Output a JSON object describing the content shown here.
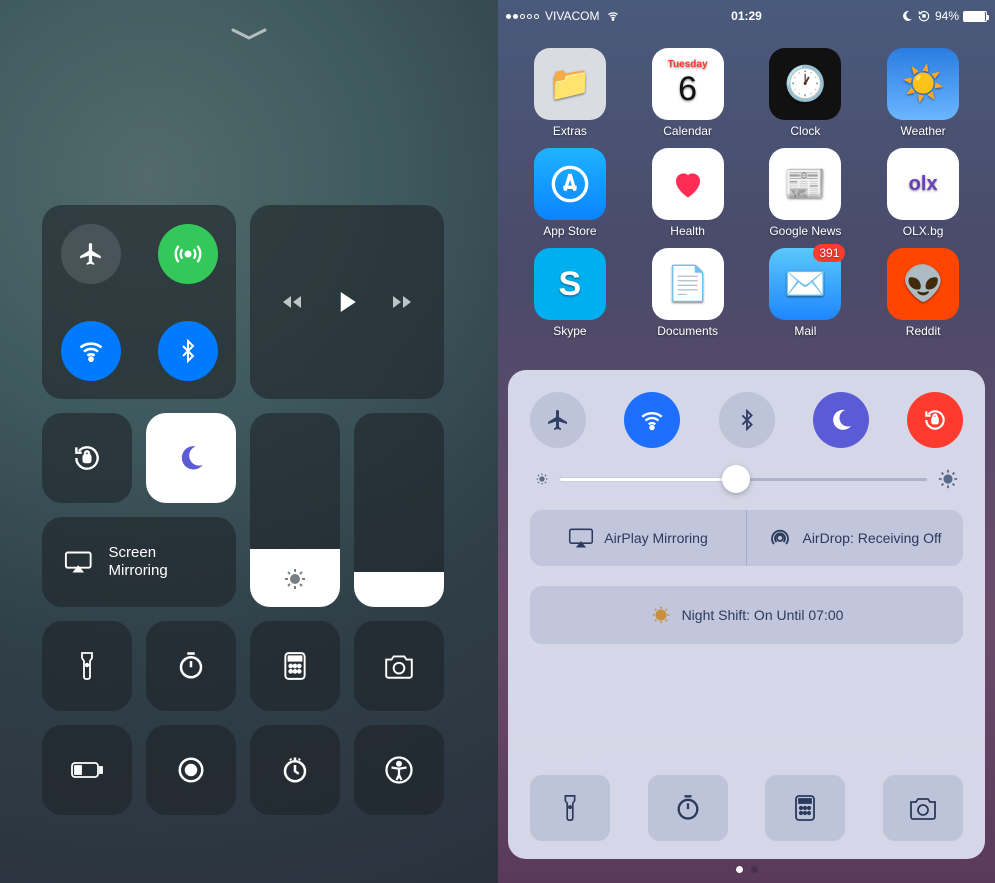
{
  "ios11": {
    "connectivity": {
      "airplane": {
        "active": false
      },
      "cellular": {
        "active": true,
        "color": "#34c759"
      },
      "wifi": {
        "active": true,
        "color": "#007aff"
      },
      "bluetooth": {
        "active": true,
        "color": "#007aff"
      }
    },
    "media": {
      "state": "paused"
    },
    "orientation_lock": {
      "active": false
    },
    "dnd": {
      "active": true
    },
    "screen_mirroring_label": "Screen Mirroring",
    "brightness_pct": 30,
    "volume_pct": 18,
    "shortcuts": [
      "flashlight",
      "timer",
      "calculator",
      "camera",
      "low-power",
      "screen-record",
      "clock",
      "accessibility"
    ]
  },
  "ios10": {
    "status": {
      "signal_dots": 2,
      "carrier": "VIVACOM",
      "wifi": true,
      "time": "01:29",
      "dnd": true,
      "orientation_lock": true,
      "battery_pct": 94
    },
    "apps": [
      {
        "label": "Extras",
        "bg": "#d9dde2"
      },
      {
        "label": "Calendar",
        "bg": "#ffffff",
        "day_name": "Tuesday",
        "day_num": "6"
      },
      {
        "label": "Clock",
        "bg": "#111111"
      },
      {
        "label": "Weather",
        "bg": "#2a7de1"
      },
      {
        "label": "App Store",
        "bg": "#1fb3ff"
      },
      {
        "label": "Health",
        "bg": "#ffffff",
        "accent": "#ff2d55"
      },
      {
        "label": "Google News",
        "bg": "#ffffff"
      },
      {
        "label": "OLX.bg",
        "bg": "#ffffff"
      },
      {
        "label": "Skype",
        "bg": "#00aff0"
      },
      {
        "label": "Documents",
        "bg": "#ffffff"
      },
      {
        "label": "Mail",
        "bg": "#1f87ff",
        "badge": "391"
      },
      {
        "label": "Reddit",
        "bg": "#ff4500"
      }
    ],
    "toggles": {
      "airplane": {
        "active": false
      },
      "wifi": {
        "active": true
      },
      "bluetooth": {
        "active": false
      },
      "dnd": {
        "active": true
      },
      "orientation_lock": {
        "active": true
      }
    },
    "brightness_pct": 48,
    "airplay_label": "AirPlay Mirroring",
    "airdrop_label": "AirDrop: Receiving Off",
    "night_shift_label": "Night Shift: On Until 07:00",
    "shortcuts": [
      "flashlight",
      "timer",
      "calculator",
      "camera"
    ],
    "page_index": 0,
    "page_count": 2
  }
}
